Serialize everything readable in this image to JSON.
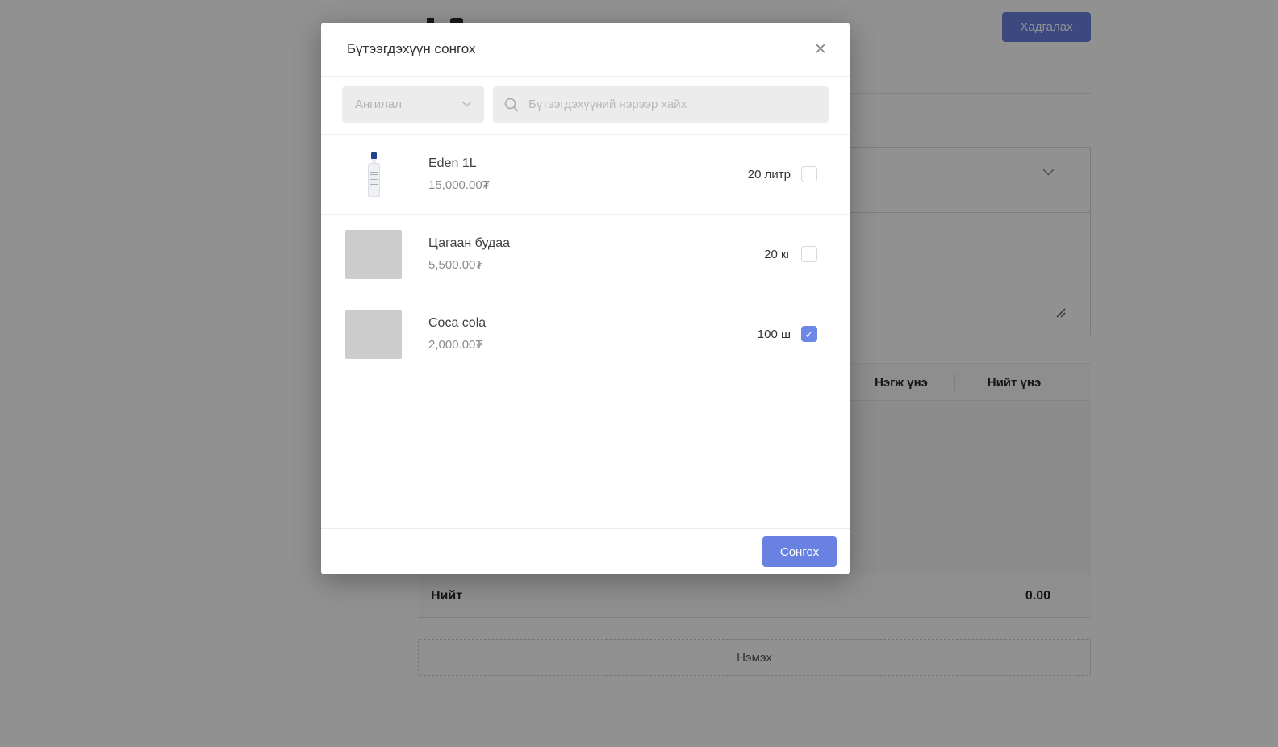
{
  "colors": {
    "accent": "#6981e0",
    "checkbox_checked": "#6d87e8",
    "overlay": "rgba(0,0,0,0.43)"
  },
  "background_page": {
    "save_button_label": "Хадгалах",
    "table": {
      "visible_headers": [
        "Нэгж үнэ",
        "Нийт үнэ"
      ]
    },
    "summary": {
      "label": "Нийт",
      "value": "0.00"
    },
    "add_button_label": "Нэмэх"
  },
  "modal": {
    "title": "Бүтээгдэхүүн сонгох",
    "close_glyph": "✕",
    "category_filter_label": "Ангилал",
    "search_placeholder": "Бүтээгдэхүүний нэрээр хайх",
    "products": [
      {
        "name": "Eden 1L",
        "price": "15,000.00₮",
        "quantity": "20 литр",
        "checked": false,
        "image": "bottle-photo"
      },
      {
        "name": "Цагаан будаа",
        "price": "5,500.00₮",
        "quantity": "20 кг",
        "checked": false,
        "image": "placeholder"
      },
      {
        "name": "Coca cola",
        "price": "2,000.00₮",
        "quantity": "100 ш",
        "checked": true,
        "image": "placeholder"
      }
    ],
    "select_button_label": "Сонгох",
    "check_glyph": "✓"
  }
}
